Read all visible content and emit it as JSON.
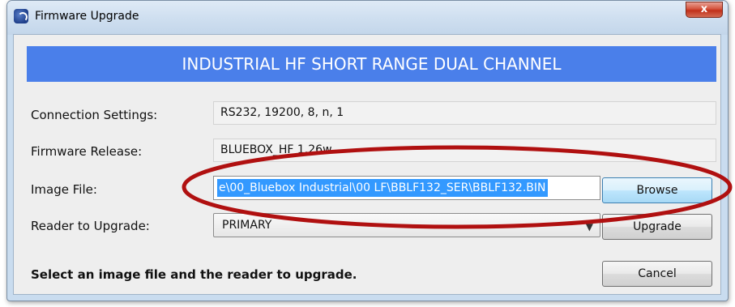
{
  "window": {
    "title": "Firmware Upgrade",
    "close_label": "x"
  },
  "banner": {
    "text": "INDUSTRIAL HF SHORT RANGE DUAL CHANNEL",
    "color": "#4a7fea"
  },
  "form": {
    "connection_label": "Connection Settings:",
    "connection_value": "RS232, 19200, 8, n, 1",
    "firmware_label": "Firmware Release:",
    "firmware_value": "BLUEBOX_HF 1.26w",
    "image_label": "Image File:",
    "image_value": "e\\00_Bluebox Industrial\\00 LF\\BBLF132_SER\\BBLF132.BIN",
    "reader_label": "Reader to Upgrade:",
    "reader_value": "PRIMARY"
  },
  "buttons": {
    "browse": "Browse",
    "upgrade": "Upgrade",
    "cancel": "Cancel"
  },
  "status_text": "Select an image file and the reader to upgrade.",
  "colors": {
    "selection": "#3399ff",
    "annotation_ellipse": "#b01010"
  }
}
